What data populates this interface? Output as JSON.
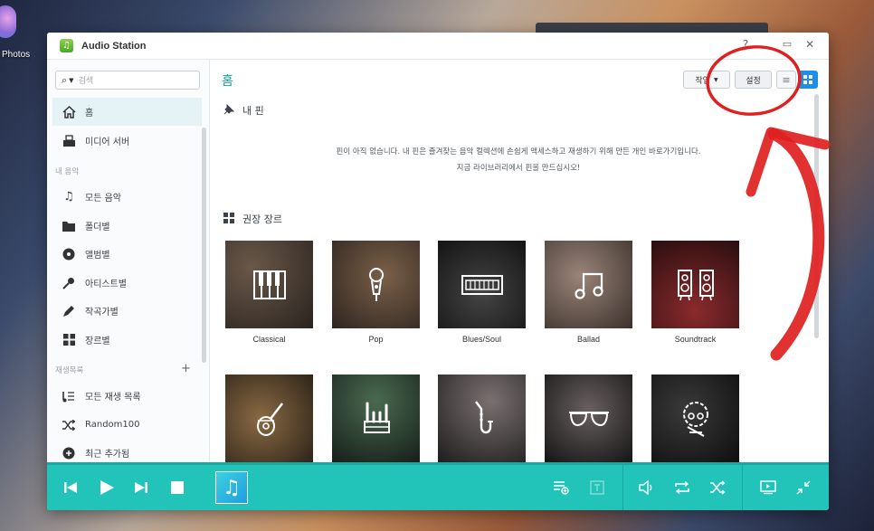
{
  "desktop": {
    "photos_label": "Photos"
  },
  "window": {
    "title": "Audio Station",
    "help": "?",
    "maximize": "▭",
    "close": "✕"
  },
  "sidebar": {
    "search_placeholder": "검색",
    "items": [
      {
        "label": "홈",
        "icon": "home-icon",
        "active": true
      },
      {
        "label": "미디어 서버",
        "icon": "media-server-icon"
      }
    ],
    "my_music_header": "내 음악",
    "my_music": [
      {
        "label": "모든 음악",
        "icon": "music-note-icon"
      },
      {
        "label": "폴더별",
        "icon": "folder-icon"
      },
      {
        "label": "앨범별",
        "icon": "album-icon"
      },
      {
        "label": "아티스트별",
        "icon": "microphone-icon"
      },
      {
        "label": "작곡가별",
        "icon": "pen-icon"
      },
      {
        "label": "장르별",
        "icon": "grid-icon"
      }
    ],
    "playlists_header": "재생목록",
    "playlists": [
      {
        "label": "모든 재생 목록",
        "icon": "playlist-icon"
      },
      {
        "label": "Random100",
        "icon": "shuffle-icon"
      },
      {
        "label": "최근 추가됨",
        "icon": "add-circle-icon"
      }
    ]
  },
  "main": {
    "title": "홈",
    "action_button": "작업",
    "settings_button": "설정",
    "pinned": {
      "header": "내 핀",
      "message_line1": "핀이 아직 없습니다. 내 핀은 즐겨찾는 음악 컬렉션에 손쉽게 액세스하고 재생하기 위해 만든 개인 바로가기입니다.",
      "message_line2": "지금 라이브러리에서 핀을 만드십시오!"
    },
    "genres_header": "권장 장르",
    "genres": [
      {
        "name": "Classical",
        "icon": "piano-icon",
        "color": "#3a3028"
      },
      {
        "name": "Pop",
        "icon": "microphone-icon",
        "color": "#4a3a30"
      },
      {
        "name": "Blues/Soul",
        "icon": "keyboard-icon",
        "color": "#2a2a2a"
      },
      {
        "name": "Ballad",
        "icon": "music-note-icon",
        "color": "#5a4a44"
      },
      {
        "name": "Soundtrack",
        "icon": "speakers-icon",
        "color": "#3a1a1c"
      },
      {
        "name": "",
        "icon": "guitar-icon",
        "color": "#4a3a2a"
      },
      {
        "name": "",
        "icon": "rock-hand-icon",
        "color": "#2a3a2e"
      },
      {
        "name": "",
        "icon": "saxophone-icon",
        "color": "#3a3434"
      },
      {
        "name": "",
        "icon": "sunglasses-icon",
        "color": "#2c2c2c"
      },
      {
        "name": "",
        "icon": "afro-guitar-icon",
        "color": "#1e1e1e"
      }
    ]
  },
  "player": {
    "colors": {
      "bar": "#22c3b8"
    }
  },
  "annotation": {
    "color": "#e02020"
  }
}
